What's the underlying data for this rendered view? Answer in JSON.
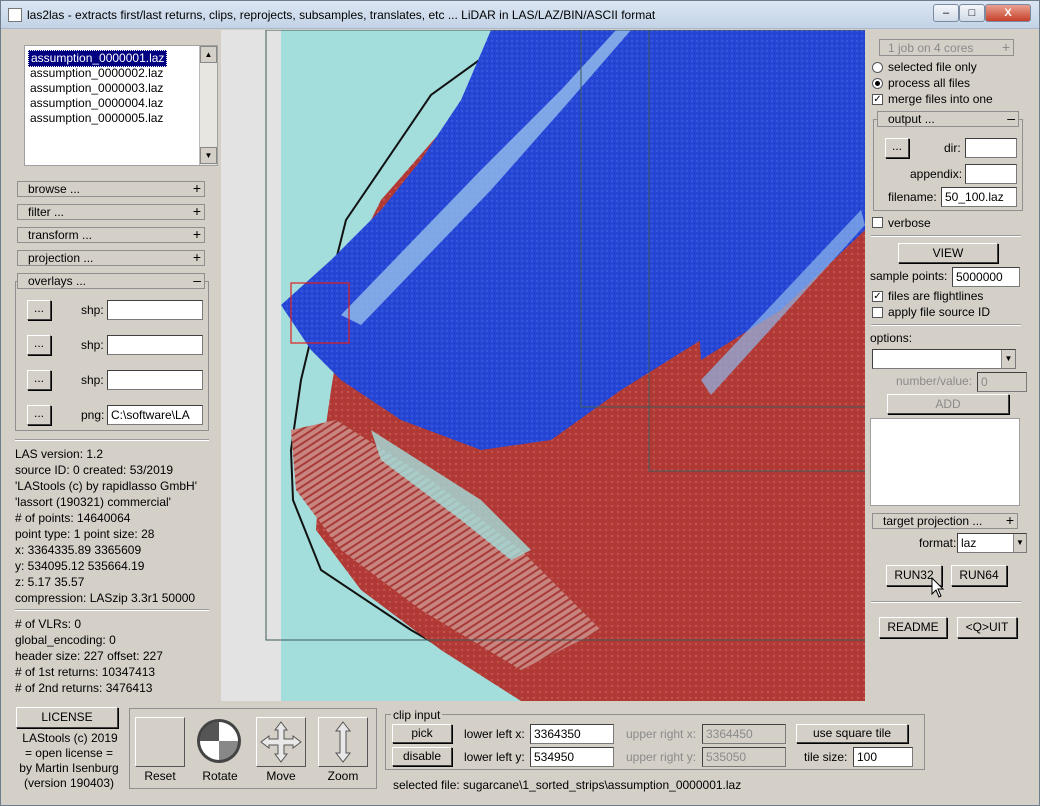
{
  "window": {
    "title": "las2las - extracts first/last returns, clips, reprojects, subsamples, translates, etc ... LiDAR in LAS/LAZ/BIN/ASCII format",
    "minimize": "–",
    "maximize": "□",
    "close": "X"
  },
  "files": [
    "assumption_0000001.laz",
    "assumption_0000002.laz",
    "assumption_0000003.laz",
    "assumption_0000004.laz",
    "assumption_0000005.laz"
  ],
  "left_bars": {
    "browse": "browse ...",
    "filter": "filter ...",
    "transform": "transform ...",
    "projection": "projection ...",
    "overlays": "overlays ..."
  },
  "overlays": [
    {
      "button": "...",
      "label": "shp:",
      "value": ""
    },
    {
      "button": "...",
      "label": "shp:",
      "value": ""
    },
    {
      "button": "...",
      "label": "shp:",
      "value": ""
    },
    {
      "button": "...",
      "label": "png:",
      "value": "C:\\software\\LA"
    }
  ],
  "las_info": [
    "LAS version: 1.2",
    "source ID:     0 created: 53/2019",
    "'LAStools (c) by rapidlasso GmbH'",
    "'lassort (190321) commercial'",
    "# of points: 14640064",
    "point type: 1 point size: 28",
    "x: 3364335.89 3365609",
    "y: 534095.12 535664.19",
    "z: 5.17 35.57",
    "compression: LASzip 3.3r1 50000"
  ],
  "las_info2": [
    "# of VLRs: 0",
    "global_encoding: 0",
    "header size: 227 offset: 227",
    "# of 1st returns: 10347413",
    "# of 2nd returns: 3476413"
  ],
  "right": {
    "cores": "1 job on 4 cores",
    "selected_only": "selected file only",
    "process_all": "process all files",
    "merge": "merge files into one",
    "output": "output ...",
    "dots": "...",
    "dir_label": "dir:",
    "dir_value": "",
    "appendix_label": "appendix:",
    "appendix_value": "",
    "filename_label": "filename:",
    "filename_value": "50_100.laz",
    "verbose": "verbose",
    "view": "VIEW",
    "sample_label": "sample points:",
    "sample_value": "5000000",
    "flightlines": "files are flightlines",
    "source_id": "apply file source ID",
    "options_label": "options:",
    "numval_label": "number/value:",
    "numval_value": "0",
    "add": "ADD",
    "target_proj": "target projection ...",
    "format_label": "format:",
    "format_value": "laz",
    "run32": "RUN32",
    "run64": "RUN64",
    "readme": "README",
    "quit": "<Q>UIT"
  },
  "bottom": {
    "license_btn": "LICENSE",
    "license_text": [
      "LAStools (c) 2019",
      "= open license =",
      "by Martin Isenburg",
      "(version 190403)"
    ],
    "tools": [
      "Reset",
      "Rotate",
      "Move",
      "Zoom"
    ],
    "clip_title": "clip input",
    "pick": "pick",
    "disable": "disable",
    "llx_label": "lower left x:",
    "llx": "3364350",
    "lly_label": "lower left y:",
    "lly": "534950",
    "urx_label": "upper right x:",
    "urx": "3364450",
    "ury_label": "upper right y:",
    "ury": "535050",
    "square": "use square tile",
    "tilesize_label": "tile size:",
    "tilesize": "100",
    "selected_file": "selected file: sugarcane\\1_sorted_strips\\assumption_0000001.laz"
  },
  "colors": {
    "ground": "#b23a36",
    "water": "#2844d2",
    "canvas": "#a3dedc",
    "light": "#e3e3e3"
  }
}
